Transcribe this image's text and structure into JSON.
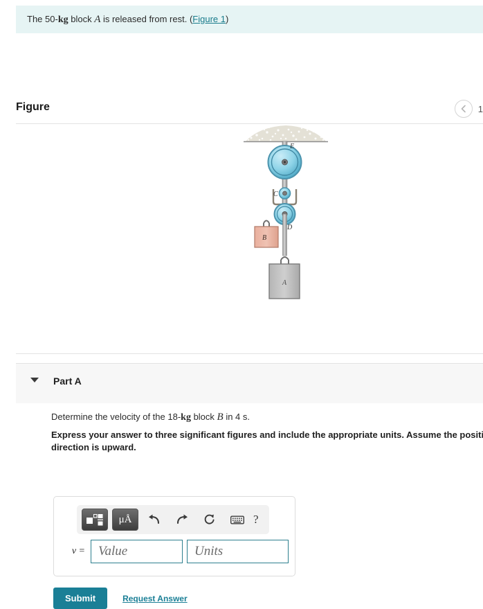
{
  "problem": {
    "text_before_mass": "The 50-",
    "mass_unit": "kg",
    "text_mid": " block ",
    "body_label": "A",
    "text_after": " is released from rest. (",
    "figure_link": "Figure 1",
    "text_close": ")"
  },
  "figure": {
    "title": "Figure",
    "prev_icon": "chevron-left-icon",
    "counter": "1",
    "diagram": {
      "ceiling_label": "",
      "pulley_e_label": "E",
      "pulley_c_label": "C",
      "pulley_d_label": "D",
      "block_b_label": "B",
      "block_a_label": "A",
      "block_b_color": "#e8a894",
      "block_a_color": "#b9b9b9",
      "pulley_color": "#8fd4e8",
      "rope_color": "#8a8274"
    }
  },
  "part": {
    "caret_icon": "caret-down-icon",
    "label": "Part A",
    "question_before": "Determine the velocity of the 18-",
    "question_unit": "kg",
    "question_mid": " block ",
    "question_body": "B",
    "question_after": " in 4 s.",
    "instruction": "Express your answer to three significant figures and include the appropriate units. Assume the positive direction is upward."
  },
  "answer": {
    "toolbar": {
      "template_icon": "math-template-icon",
      "units_label": "μÅ",
      "undo_icon": "undo-arrow-icon",
      "redo_icon": "redo-arrow-icon",
      "reset_icon": "reset-circular-arrow-icon",
      "keyboard_icon": "keyboard-icon",
      "help_label": "?"
    },
    "variable_label": "v =",
    "value_placeholder": "Value",
    "value_current": "",
    "units_placeholder": "Units",
    "units_current": ""
  },
  "actions": {
    "submit_label": "Submit",
    "request_answer_label": "Request Answer"
  },
  "colors": {
    "banner_bg": "#e6f4f4",
    "accent_teal": "#1a7f96",
    "part_header_bg": "#f7f7f7"
  }
}
